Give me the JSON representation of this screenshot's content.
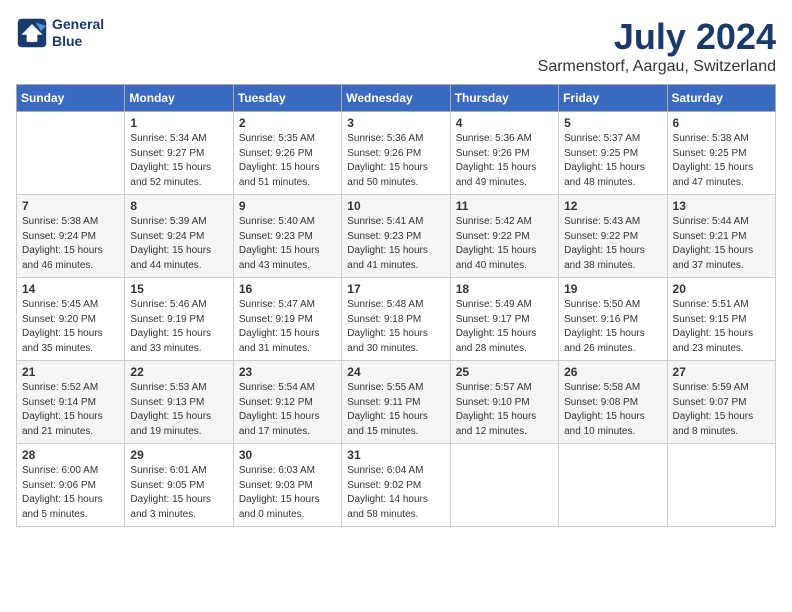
{
  "header": {
    "logo_line1": "General",
    "logo_line2": "Blue",
    "month_year": "July 2024",
    "location": "Sarmenstorf, Aargau, Switzerland"
  },
  "weekdays": [
    "Sunday",
    "Monday",
    "Tuesday",
    "Wednesday",
    "Thursday",
    "Friday",
    "Saturday"
  ],
  "weeks": [
    [
      {
        "day": "",
        "info": ""
      },
      {
        "day": "1",
        "info": "Sunrise: 5:34 AM\nSunset: 9:27 PM\nDaylight: 15 hours\nand 52 minutes."
      },
      {
        "day": "2",
        "info": "Sunrise: 5:35 AM\nSunset: 9:26 PM\nDaylight: 15 hours\nand 51 minutes."
      },
      {
        "day": "3",
        "info": "Sunrise: 5:36 AM\nSunset: 9:26 PM\nDaylight: 15 hours\nand 50 minutes."
      },
      {
        "day": "4",
        "info": "Sunrise: 5:36 AM\nSunset: 9:26 PM\nDaylight: 15 hours\nand 49 minutes."
      },
      {
        "day": "5",
        "info": "Sunrise: 5:37 AM\nSunset: 9:25 PM\nDaylight: 15 hours\nand 48 minutes."
      },
      {
        "day": "6",
        "info": "Sunrise: 5:38 AM\nSunset: 9:25 PM\nDaylight: 15 hours\nand 47 minutes."
      }
    ],
    [
      {
        "day": "7",
        "info": "Sunrise: 5:38 AM\nSunset: 9:24 PM\nDaylight: 15 hours\nand 46 minutes."
      },
      {
        "day": "8",
        "info": "Sunrise: 5:39 AM\nSunset: 9:24 PM\nDaylight: 15 hours\nand 44 minutes."
      },
      {
        "day": "9",
        "info": "Sunrise: 5:40 AM\nSunset: 9:23 PM\nDaylight: 15 hours\nand 43 minutes."
      },
      {
        "day": "10",
        "info": "Sunrise: 5:41 AM\nSunset: 9:23 PM\nDaylight: 15 hours\nand 41 minutes."
      },
      {
        "day": "11",
        "info": "Sunrise: 5:42 AM\nSunset: 9:22 PM\nDaylight: 15 hours\nand 40 minutes."
      },
      {
        "day": "12",
        "info": "Sunrise: 5:43 AM\nSunset: 9:22 PM\nDaylight: 15 hours\nand 38 minutes."
      },
      {
        "day": "13",
        "info": "Sunrise: 5:44 AM\nSunset: 9:21 PM\nDaylight: 15 hours\nand 37 minutes."
      }
    ],
    [
      {
        "day": "14",
        "info": "Sunrise: 5:45 AM\nSunset: 9:20 PM\nDaylight: 15 hours\nand 35 minutes."
      },
      {
        "day": "15",
        "info": "Sunrise: 5:46 AM\nSunset: 9:19 PM\nDaylight: 15 hours\nand 33 minutes."
      },
      {
        "day": "16",
        "info": "Sunrise: 5:47 AM\nSunset: 9:19 PM\nDaylight: 15 hours\nand 31 minutes."
      },
      {
        "day": "17",
        "info": "Sunrise: 5:48 AM\nSunset: 9:18 PM\nDaylight: 15 hours\nand 30 minutes."
      },
      {
        "day": "18",
        "info": "Sunrise: 5:49 AM\nSunset: 9:17 PM\nDaylight: 15 hours\nand 28 minutes."
      },
      {
        "day": "19",
        "info": "Sunrise: 5:50 AM\nSunset: 9:16 PM\nDaylight: 15 hours\nand 26 minutes."
      },
      {
        "day": "20",
        "info": "Sunrise: 5:51 AM\nSunset: 9:15 PM\nDaylight: 15 hours\nand 23 minutes."
      }
    ],
    [
      {
        "day": "21",
        "info": "Sunrise: 5:52 AM\nSunset: 9:14 PM\nDaylight: 15 hours\nand 21 minutes."
      },
      {
        "day": "22",
        "info": "Sunrise: 5:53 AM\nSunset: 9:13 PM\nDaylight: 15 hours\nand 19 minutes."
      },
      {
        "day": "23",
        "info": "Sunrise: 5:54 AM\nSunset: 9:12 PM\nDaylight: 15 hours\nand 17 minutes."
      },
      {
        "day": "24",
        "info": "Sunrise: 5:55 AM\nSunset: 9:11 PM\nDaylight: 15 hours\nand 15 minutes."
      },
      {
        "day": "25",
        "info": "Sunrise: 5:57 AM\nSunset: 9:10 PM\nDaylight: 15 hours\nand 12 minutes."
      },
      {
        "day": "26",
        "info": "Sunrise: 5:58 AM\nSunset: 9:08 PM\nDaylight: 15 hours\nand 10 minutes."
      },
      {
        "day": "27",
        "info": "Sunrise: 5:59 AM\nSunset: 9:07 PM\nDaylight: 15 hours\nand 8 minutes."
      }
    ],
    [
      {
        "day": "28",
        "info": "Sunrise: 6:00 AM\nSunset: 9:06 PM\nDaylight: 15 hours\nand 5 minutes."
      },
      {
        "day": "29",
        "info": "Sunrise: 6:01 AM\nSunset: 9:05 PM\nDaylight: 15 hours\nand 3 minutes."
      },
      {
        "day": "30",
        "info": "Sunrise: 6:03 AM\nSunset: 9:03 PM\nDaylight: 15 hours\nand 0 minutes."
      },
      {
        "day": "31",
        "info": "Sunrise: 6:04 AM\nSunset: 9:02 PM\nDaylight: 14 hours\nand 58 minutes."
      },
      {
        "day": "",
        "info": ""
      },
      {
        "day": "",
        "info": ""
      },
      {
        "day": "",
        "info": ""
      }
    ]
  ]
}
